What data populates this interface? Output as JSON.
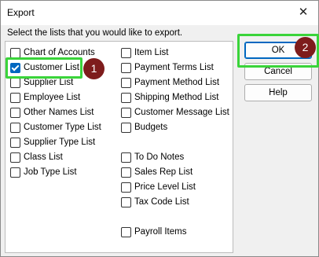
{
  "window": {
    "title": "Export"
  },
  "instruction": "Select the lists that you would like to export.",
  "left_column": [
    {
      "label": "Chart of Accounts",
      "checked": false
    },
    {
      "label": "Customer List",
      "checked": true
    },
    {
      "label": "Supplier List",
      "checked": false
    },
    {
      "label": "Employee List",
      "checked": false
    },
    {
      "label": "Other Names List",
      "checked": false
    },
    {
      "label": "Customer Type List",
      "checked": false
    },
    {
      "label": "Supplier Type List",
      "checked": false
    },
    {
      "label": "Class List",
      "checked": false
    },
    {
      "label": "Job Type List",
      "checked": false
    }
  ],
  "right_column": [
    {
      "label": "Item List",
      "checked": false
    },
    {
      "label": "Payment Terms List",
      "checked": false
    },
    {
      "label": "Payment Method List",
      "checked": false
    },
    {
      "label": "Shipping Method List",
      "checked": false
    },
    {
      "label": "Customer Message List",
      "checked": false
    },
    {
      "label": "Budgets",
      "checked": false
    },
    {
      "label": "To Do Notes",
      "checked": false
    },
    {
      "label": "Sales Rep List",
      "checked": false
    },
    {
      "label": "Price Level List",
      "checked": false
    },
    {
      "label": "Tax Code List",
      "checked": false
    },
    {
      "label": "Payroll Items",
      "checked": false
    }
  ],
  "buttons": {
    "ok": "OK",
    "cancel": "Cancel",
    "help": "Help"
  },
  "annotations": {
    "step1": "1",
    "step2": "2"
  },
  "colors": {
    "highlight": "#3ad43a",
    "badge": "#7e1c1c",
    "accent": "#0067c0"
  }
}
